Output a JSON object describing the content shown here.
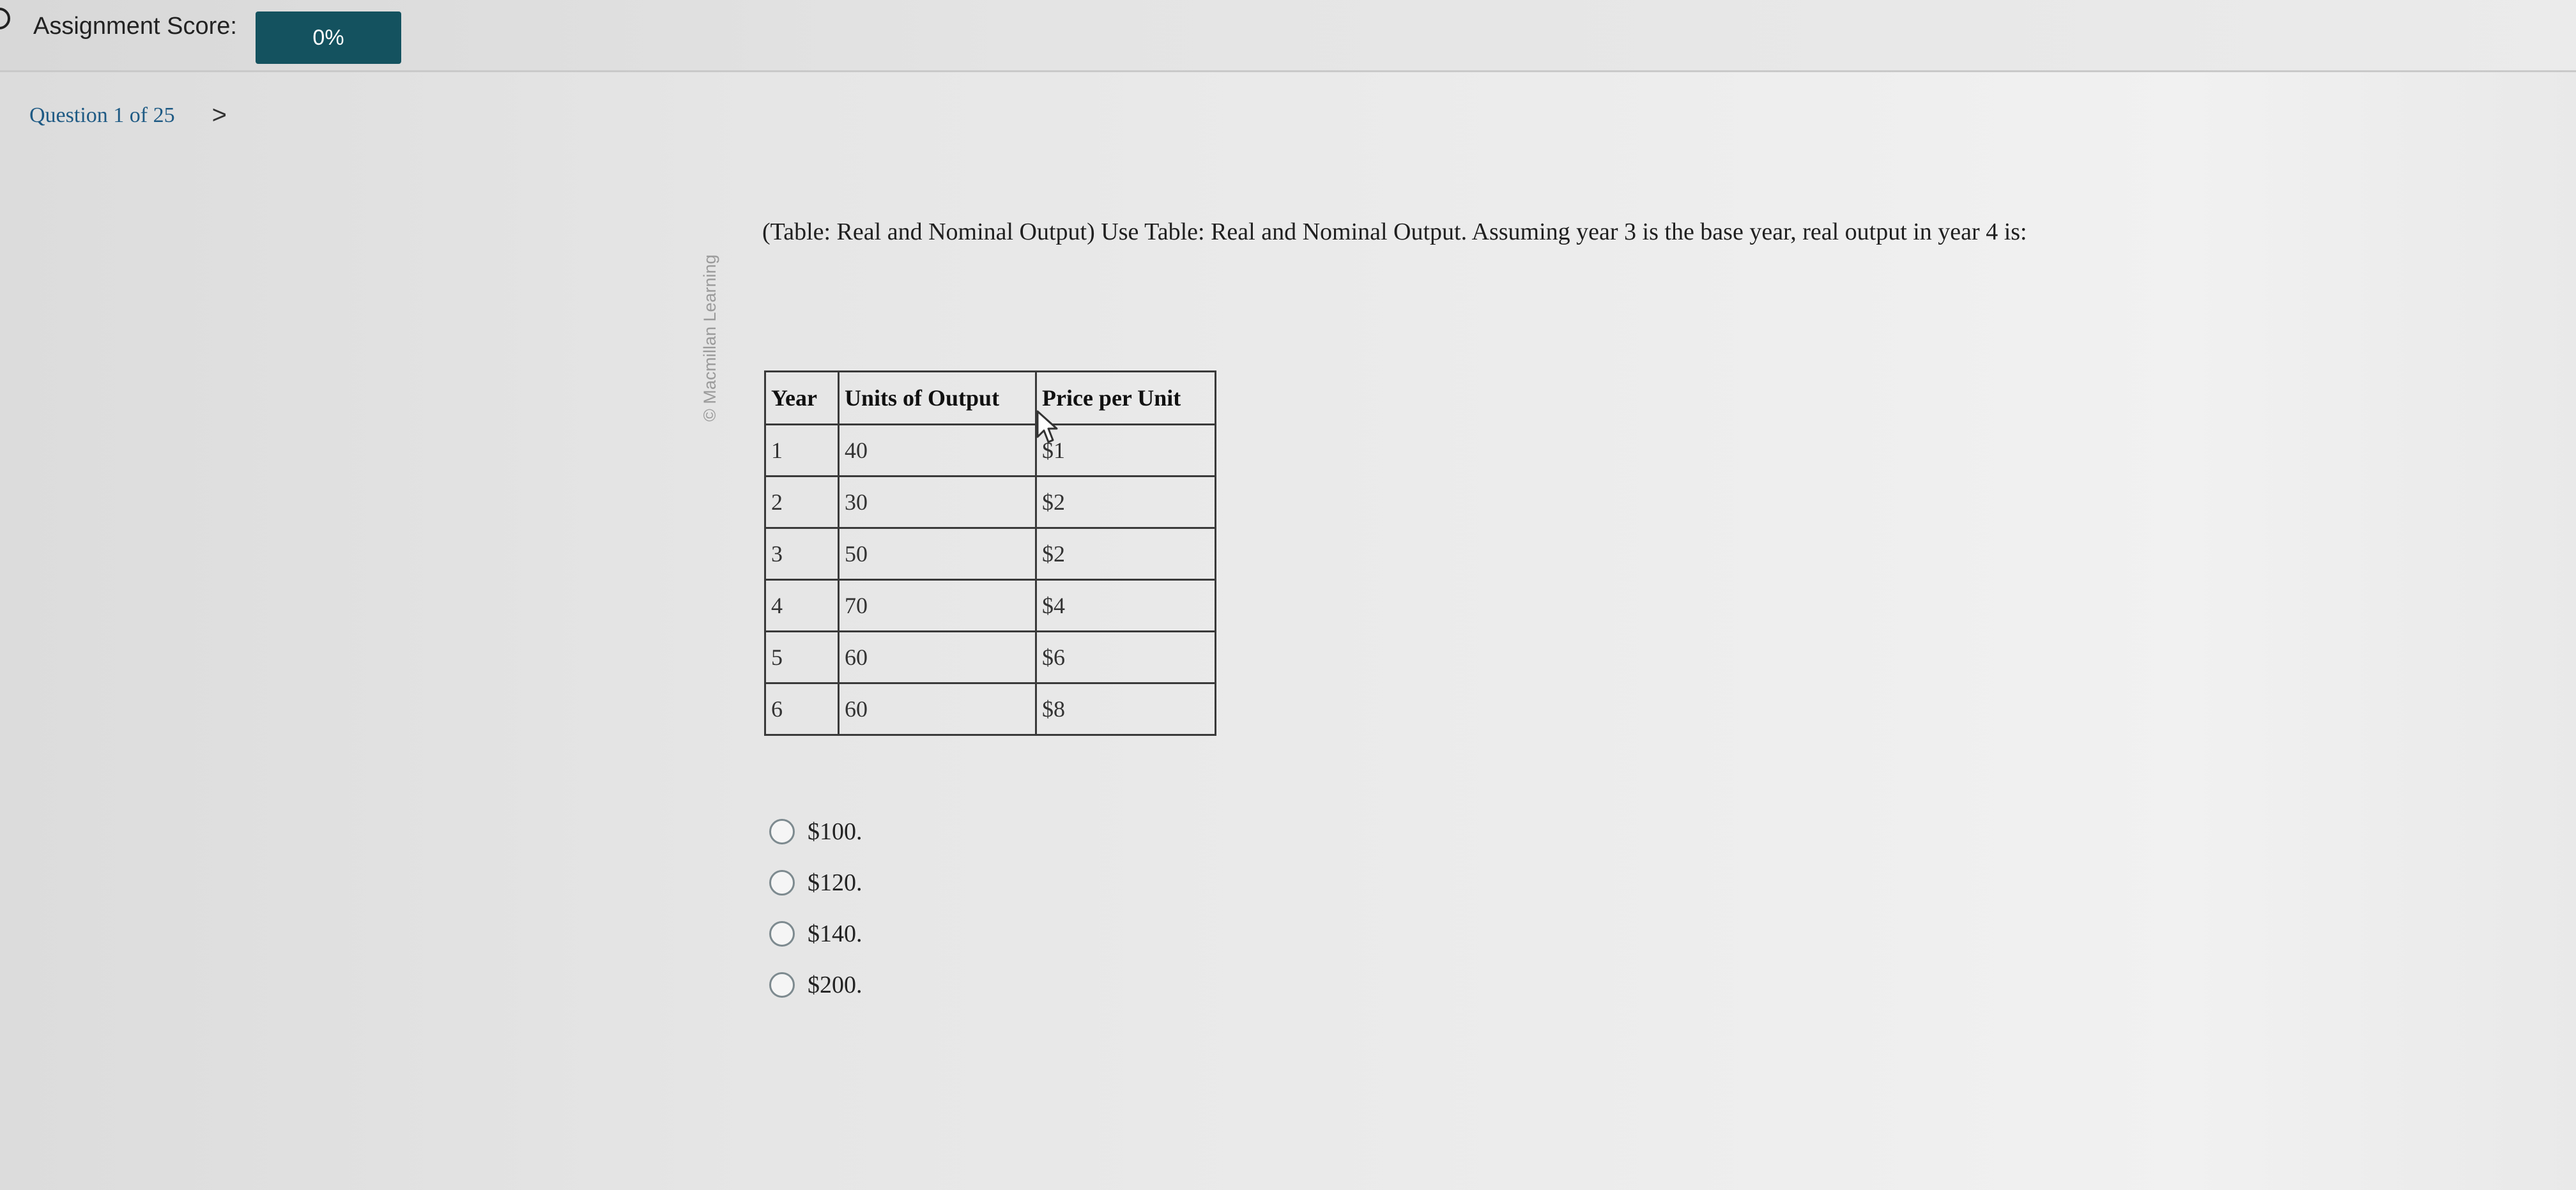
{
  "header": {
    "score_label": "Assignment Score:",
    "score_value": "0%"
  },
  "nav": {
    "question_label": "Question 1 of 25",
    "next_icon": "chevron-right-icon",
    "next_glyph": ">"
  },
  "credit": {
    "text": "© Macmillan Learning"
  },
  "question": {
    "text": "(Table: Real and Nominal Output) Use Table: Real and Nominal Output. Assuming year 3 is the base year, real output in year 4 is:"
  },
  "table": {
    "headers": [
      "Year",
      "Units of Output",
      "Price per Unit"
    ],
    "rows": [
      [
        "1",
        "40",
        "$1"
      ],
      [
        "2",
        "30",
        "$2"
      ],
      [
        "3",
        "50",
        "$2"
      ],
      [
        "4",
        "70",
        "$4"
      ],
      [
        "5",
        "60",
        "$6"
      ],
      [
        "6",
        "60",
        "$8"
      ]
    ]
  },
  "choices": [
    {
      "label": "$100."
    },
    {
      "label": "$120."
    },
    {
      "label": "$140."
    },
    {
      "label": "$200."
    }
  ],
  "colors": {
    "score_badge": "#14525f",
    "question_link": "#1e5a84"
  }
}
